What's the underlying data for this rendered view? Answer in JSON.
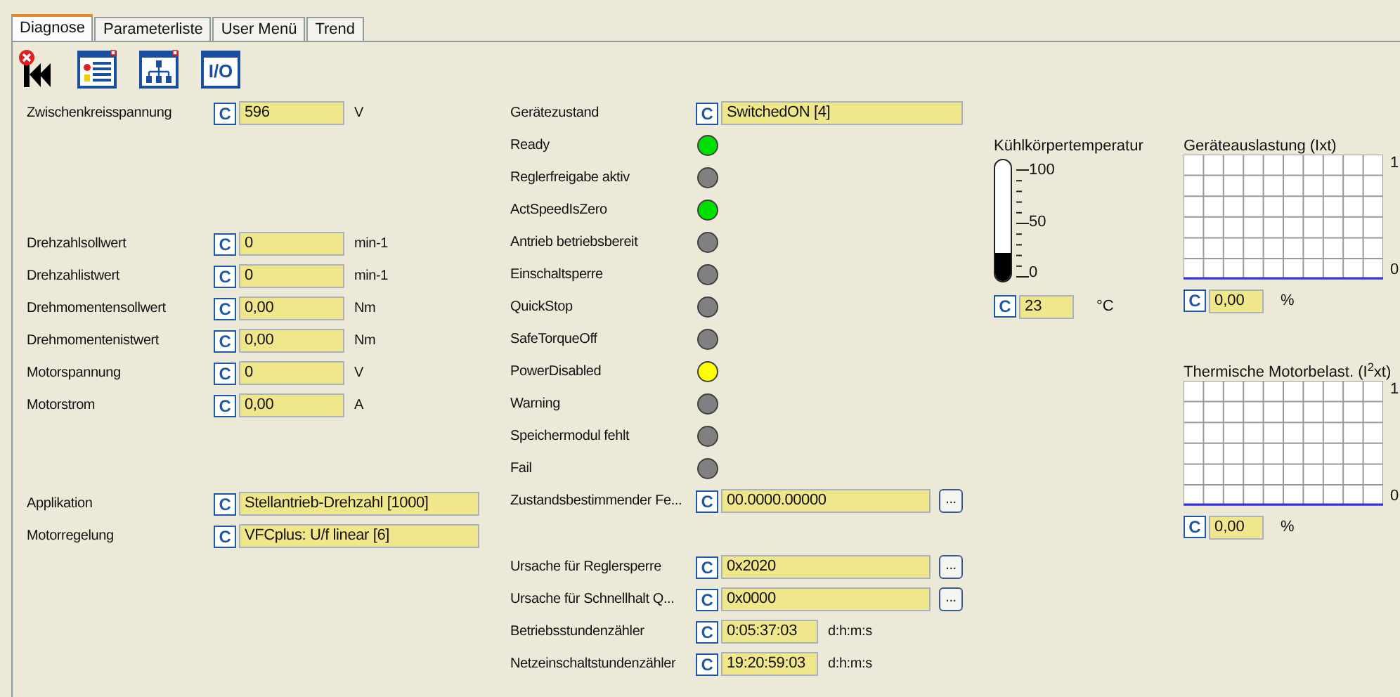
{
  "tabs": [
    {
      "label": "Diagnose",
      "selected": true
    },
    {
      "label": "Parameterliste",
      "selected": false
    },
    {
      "label": "User Menü",
      "selected": false
    },
    {
      "label": "Trend",
      "selected": false
    }
  ],
  "toolbar": [
    {
      "kind": "reset"
    },
    {
      "kind": "list"
    },
    {
      "kind": "tree"
    },
    {
      "kind": "io",
      "label": "I/O"
    }
  ],
  "left_groups": [
    [
      {
        "kind": "field_unit",
        "label": "Zwischenkreisspannung",
        "c_label": "C",
        "value": "596",
        "unit": "V"
      }
    ],
    [
      {
        "kind": "field_unit",
        "label": "Drehzahlsollwert",
        "c_label": "C",
        "value": "0",
        "unit": "min-1"
      },
      {
        "kind": "field_unit",
        "label": "Drehzahlistwert",
        "c_label": "C",
        "value": "0",
        "unit": "min-1"
      },
      {
        "kind": "field_unit",
        "label": "Drehmomentensollwert",
        "c_label": "C",
        "value": "0,00",
        "unit": "Nm"
      },
      {
        "kind": "field_unit",
        "label": "Drehmomentenistwert",
        "c_label": "C",
        "value": "0,00",
        "unit": "Nm"
      },
      {
        "kind": "field_unit",
        "label": "Motorspannung",
        "c_label": "C",
        "value": "0",
        "unit": "V"
      },
      {
        "kind": "field_unit",
        "label": "Motorstrom",
        "c_label": "C",
        "value": "0,00",
        "unit": "A"
      }
    ],
    [
      {
        "kind": "field",
        "label": "Applikation",
        "c_label": "C",
        "value": "Stellantrieb-Drehzahl [1000]"
      },
      {
        "kind": "field",
        "label": "Motorregelung",
        "c_label": "C",
        "value": "VFCplus: U/f linear [6]"
      }
    ]
  ],
  "status_groups": [
    [
      {
        "kind": "field",
        "label": "Gerätezustand",
        "c_label": "C",
        "value": "SwitchedON [4]"
      },
      {
        "kind": "led",
        "label": "Ready",
        "color": "#00e000"
      },
      {
        "kind": "led",
        "label": "Reglerfreigabe aktiv",
        "color": "#808080"
      },
      {
        "kind": "led",
        "label": "ActSpeedIsZero",
        "color": "#00e000"
      },
      {
        "kind": "led",
        "label": "Antrieb betriebsbereit",
        "color": "#808080"
      },
      {
        "kind": "led",
        "label": "Einschaltsperre",
        "color": "#808080"
      },
      {
        "kind": "led",
        "label": "QuickStop",
        "color": "#808080"
      },
      {
        "kind": "led",
        "label": "SafeTorqueOff",
        "color": "#808080"
      },
      {
        "kind": "led",
        "label": "PowerDisabled",
        "color": "#ffff00"
      },
      {
        "kind": "led",
        "label": "Warning",
        "color": "#808080"
      },
      {
        "kind": "led",
        "label": "Speichermodul fehlt",
        "color": "#808080"
      },
      {
        "kind": "led",
        "label": "Fail",
        "color": "#808080"
      },
      {
        "kind": "field_button",
        "label": "Zustandsbestimmender Fe...",
        "c_label": "C",
        "value": "00.0000.00000",
        "button": "..."
      }
    ],
    [
      {
        "kind": "field_button",
        "label": "Ursache für Reglersperre",
        "c_label": "C",
        "value": "0x2020",
        "button": "..."
      },
      {
        "kind": "field_button",
        "label": "Ursache für Schnellhalt Q...",
        "c_label": "C",
        "value": "0x0000",
        "button": "..."
      },
      {
        "kind": "field_unit",
        "label": "Betriebsstundenzähler",
        "c_label": "C",
        "value": "0:05:37:03",
        "unit": "d:h:m:s"
      },
      {
        "kind": "field_unit",
        "label": "Netzeinschaltstundenzähler",
        "c_label": "C",
        "value": "19:20:59:03",
        "unit": "d:h:m:s"
      }
    ]
  ],
  "temperature": {
    "title": "Kühlkörpertemperatur",
    "level": 0.23,
    "ticks": [
      "100",
      "50",
      "0"
    ],
    "c_label": "C",
    "value": "23",
    "unit": "°C"
  },
  "charts": [
    {
      "title": "Geräteauslastung (Ixt)",
      "y_max_label": "1",
      "y_min_label": "0",
      "c_label": "C",
      "value": "0,00",
      "unit": "%"
    },
    {
      "title": "Thermische Motorbelast. (I$^{2}$xt)",
      "y_max_label": "1",
      "y_min_label": "0",
      "c_label": "C",
      "value": "0,00",
      "unit": "%"
    }
  ]
}
